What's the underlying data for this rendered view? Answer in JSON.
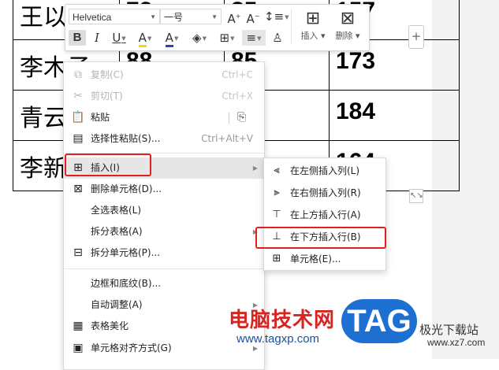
{
  "table": {
    "rows": [
      {
        "name": "王以",
        "v1": "72",
        "v2": "85",
        "total": "157"
      },
      {
        "name": "李木子",
        "v1": "88",
        "v2": "85",
        "total": "173"
      },
      {
        "name": "青云",
        "v1": "",
        "v2": "",
        "total": "184"
      },
      {
        "name": "李新",
        "v1": "",
        "v2": "",
        "total": "164"
      }
    ]
  },
  "controls": {
    "add_column": "+",
    "resize": "↖↘"
  },
  "toolbar": {
    "font_name": "Helvetica",
    "font_size": "一号",
    "bold": "B",
    "italic": "I",
    "underline": "U",
    "highlight": "A",
    "font_color": "A",
    "insert_label": "插入",
    "delete_label": "删除"
  },
  "context_menu": {
    "copy": {
      "label": "复制(C)",
      "shortcut": "Ctrl+C"
    },
    "cut": {
      "label": "剪切(T)",
      "shortcut": "Ctrl+X"
    },
    "paste": {
      "label": "粘贴"
    },
    "paste_special": {
      "label": "选择性粘贴(S)...",
      "shortcut": "Ctrl+Alt+V"
    },
    "insert": {
      "label": "插入(I)"
    },
    "delete_cells": {
      "label": "删除单元格(D)..."
    },
    "select_table": {
      "label": "全选表格(L)"
    },
    "split_table": {
      "label": "拆分表格(A)"
    },
    "split_cells": {
      "label": "拆分单元格(P)..."
    },
    "borders": {
      "label": "边框和底纹(B)..."
    },
    "autofit": {
      "label": "自动调整(A)"
    },
    "beautify": {
      "label": "表格美化"
    },
    "cell_align": {
      "label": "单元格对齐方式(G)"
    }
  },
  "submenu": {
    "insert_col_left": "在左侧插入列(L)",
    "insert_col_right": "在右侧插入列(R)",
    "insert_row_above": "在上方插入行(A)",
    "insert_row_below": "在下方插入行(B)",
    "insert_cells": "单元格(E)..."
  },
  "watermark": {
    "site_name": "电脑技术网",
    "url": "www.tagxp.com",
    "tag": "TAG",
    "right_text": "极光下载站",
    "right_url": "www.xz7.com"
  },
  "colors": {
    "highlight_red": "#e02020",
    "tag_blue": "#1e6fd2",
    "watermark_red": "#d8241f"
  }
}
